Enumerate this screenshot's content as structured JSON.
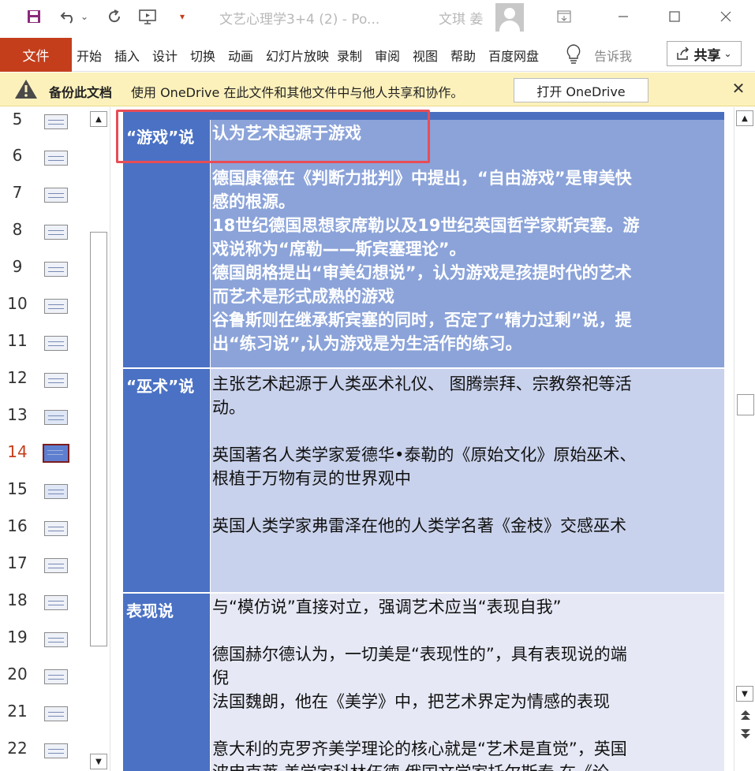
{
  "window": {
    "title": "文艺心理学3+4 (2)  -  Po...",
    "user": "文琪 姜",
    "controls": {
      "minimize": "minimize-icon",
      "restore": "restore-icon",
      "close": "close-icon"
    }
  },
  "quick_access": {
    "save_icon": "save-icon",
    "undo_icon": "undo-icon",
    "redo_icon": "redo-icon",
    "present_icon": "present-from-start-icon",
    "dropdown_glyph": "▾"
  },
  "ribbon": {
    "file": "文件",
    "tabs": [
      "开始",
      "插入",
      "设计",
      "切换",
      "动画",
      "幻灯片放映",
      "录制",
      "审阅",
      "视图",
      "帮助",
      "百度网盘"
    ],
    "tell_me": "告诉我",
    "share": "共享"
  },
  "infobar": {
    "title": "备份此文档",
    "message": "使用 OneDrive 在此文件和其他文件中与他人共享和协作。",
    "button": "打开 OneDrive"
  },
  "thumbnails": {
    "numbers": [
      "5",
      "6",
      "7",
      "8",
      "9",
      "10",
      "11",
      "12",
      "13",
      "14",
      "15",
      "16",
      "17",
      "18",
      "19",
      "20",
      "21",
      "22"
    ],
    "active": "14"
  },
  "slide": {
    "rows": [
      {
        "head": "“游戏”说",
        "lines": [
          "认为艺术起源于游戏",
          "",
          "德国康德在《判断力批判》中提出，“自由游戏”是审美快",
          "感的根源。",
          "18世纪德国思想家席勒以及19世纪英国哲学家斯宾塞。游",
          "戏说称为“席勒——斯宾塞理论”。",
          "德国朗格提出“审美幻想说”，认为游戏是孩提时代的艺术",
          "而艺术是形式成熟的游戏",
          "谷鲁斯则在继承斯宾塞的同时，否定了“精力过剩”说，提",
          "出“练习说”,认为游戏是为生活作的练习。"
        ]
      },
      {
        "head": "“巫术”说",
        "lines": [
          "主张艺术起源于人类巫术礼仪、 图腾崇拜、宗教祭祀等活",
          "动。",
          "",
          "英国著名人类学家爱德华•泰勒的《原始文化》原始巫术、",
          "根植于万物有灵的世界观中",
          "",
          "英国人类学家弗雷泽在他的人类学名著《金枝》交感巫术"
        ]
      },
      {
        "head": "表现说",
        "lines": [
          "与“模仿说”直接对立，强调艺术应当“表现自我”",
          "",
          "德国赫尔德认为，一切美是“表现性的”，具有表现说的端",
          "倪",
          "法国魏朗，他在《美学》中，把艺术界定为情感的表现",
          "",
          "意大利的克罗齐美学理论的核心就是“艺术是直觉”，英国",
          "波申克莱   美学家科林伍德    俄国文学家托尔斯泰 在《论"
        ]
      }
    ]
  },
  "colors": {
    "file_tab": "#c43e1c",
    "infobar": "#fdf1bb",
    "table_head": "#4a71c4",
    "row1": "#8ba3d9",
    "row2": "#c9d2ec",
    "row3": "#e6e9f5",
    "highlight": "#e84d56"
  }
}
